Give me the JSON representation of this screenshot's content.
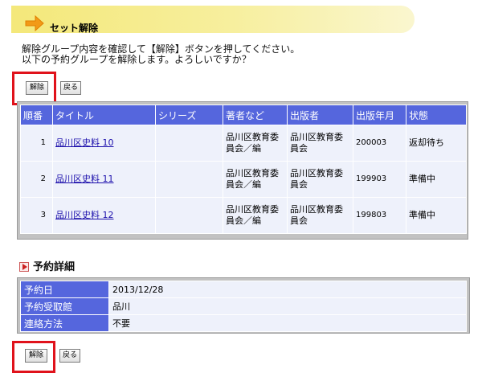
{
  "page": {
    "title": "セット解除",
    "instructions": [
      "解除グループ内容を確認して【解除】ボタンを押してください。",
      "以下の予約グループを解除します。よろしいですか？"
    ]
  },
  "buttons": {
    "cancel_label": "解除",
    "back_label": "戻る"
  },
  "list": {
    "headers": [
      "順番",
      "タイトル",
      "シリーズ",
      "著者など",
      "出版者",
      "出版年月",
      "状態"
    ],
    "rows": [
      {
        "order": "1",
        "title": "品川区史料 10",
        "series": "",
        "author": "品川区教育委員会／編",
        "publisher": "品川区教育委員会",
        "date": "200003",
        "status": "返却待ち"
      },
      {
        "order": "2",
        "title": "品川区史料 11",
        "series": "",
        "author": "品川区教育委員会／編",
        "publisher": "品川区教育委員会",
        "date": "199903",
        "status": "準備中"
      },
      {
        "order": "3",
        "title": "品川区史料 12",
        "series": "",
        "author": "品川区教育委員会／編",
        "publisher": "品川区教育委員会",
        "date": "199803",
        "status": "準備中"
      }
    ]
  },
  "detail": {
    "heading": "予約詳細",
    "rows": [
      {
        "label": "予約日",
        "value": "2013/12/28"
      },
      {
        "label": "予約受取館",
        "value": "品川"
      },
      {
        "label": "連絡方法",
        "value": "不要"
      }
    ]
  },
  "colors": {
    "header_bg": "#5566dd",
    "cell_bg": "#eef1fb",
    "highlight": "#e0121b",
    "title_band": "#f4e87a"
  },
  "icons": [
    "arrow-right-icon",
    "section-marker-icon"
  ]
}
